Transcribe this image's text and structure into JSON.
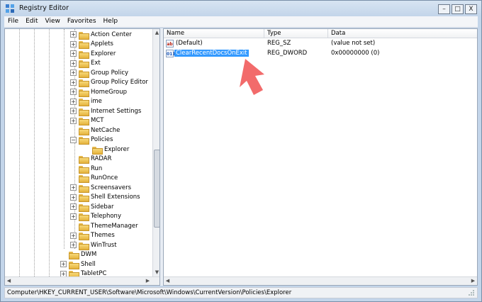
{
  "window": {
    "title": "Registry Editor",
    "minimize": "–",
    "maximize": "□",
    "close": "X"
  },
  "menu": [
    "File",
    "Edit",
    "View",
    "Favorites",
    "Help"
  ],
  "tree": [
    {
      "label": "Action Center",
      "expander": "+"
    },
    {
      "label": "Applets",
      "expander": "+"
    },
    {
      "label": "Explorer",
      "expander": "+"
    },
    {
      "label": "Ext",
      "expander": "+"
    },
    {
      "label": "Group Policy",
      "expander": "+"
    },
    {
      "label": "Group Policy Editor",
      "expander": "+"
    },
    {
      "label": "HomeGroup",
      "expander": "+"
    },
    {
      "label": "ime",
      "expander": "+"
    },
    {
      "label": "Internet Settings",
      "expander": "+"
    },
    {
      "label": "MCT",
      "expander": "+"
    },
    {
      "label": "NetCache",
      "expander": ""
    },
    {
      "label": "Policies",
      "expander": "−"
    },
    {
      "label": "Explorer",
      "expander": ""
    },
    {
      "label": "RADAR",
      "expander": ""
    },
    {
      "label": "Run",
      "expander": ""
    },
    {
      "label": "RunOnce",
      "expander": ""
    },
    {
      "label": "Screensavers",
      "expander": "+"
    },
    {
      "label": "Shell Extensions",
      "expander": "+"
    },
    {
      "label": "Sidebar",
      "expander": "+"
    },
    {
      "label": "Telephony",
      "expander": "+"
    },
    {
      "label": "ThemeManager",
      "expander": ""
    },
    {
      "label": "Themes",
      "expander": "+"
    },
    {
      "label": "WinTrust",
      "expander": "+"
    },
    {
      "label": "DWM",
      "expander": ""
    },
    {
      "label": "Shell",
      "expander": "+"
    },
    {
      "label": "TabletPC",
      "expander": "+"
    }
  ],
  "list": {
    "columns": [
      "Name",
      "Type",
      "Data"
    ],
    "rows": [
      {
        "icon": "ab",
        "name": "(Default)",
        "type": "REG_SZ",
        "data": "(value not set)"
      },
      {
        "icon": "011",
        "name": "ClearRecentDocsOnExit",
        "type": "REG_DWORD",
        "data": "0x00000000 (0)"
      }
    ]
  },
  "status": {
    "path": "Computer\\HKEY_CURRENT_USER\\Software\\Microsoft\\Windows\\CurrentVersion\\Policies\\Explorer"
  },
  "annotation": {
    "arrow_color": "#f26b6b"
  }
}
